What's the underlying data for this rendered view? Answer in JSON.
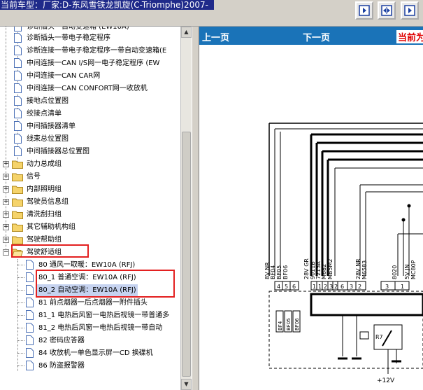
{
  "window": {
    "title": "当前车型：厂家:D-东风雪铁龙凯旋(C-Triomphe)2007-"
  },
  "toolbar": {
    "icons": [
      "prev-page-icon",
      "fit-width-icon",
      "next-page-icon"
    ]
  },
  "tree": {
    "items": [
      {
        "label": "诊断插头一带电子稳定程序",
        "kind": "doc"
      },
      {
        "label": "诊断连接一带电子稳定程序一带自动变速箱(E",
        "kind": "doc"
      },
      {
        "label": "中间连接一CAN I/S网一电子稳定程序 (EW",
        "kind": "doc"
      },
      {
        "label": "中间连接一CAN CAR网",
        "kind": "doc"
      },
      {
        "label": "中间连接一CAN CONFORT网一收放机",
        "kind": "doc"
      },
      {
        "label": "接地点位置图",
        "kind": "doc"
      },
      {
        "label": "绞接点清单",
        "kind": "doc"
      },
      {
        "label": "中间插接器清单",
        "kind": "doc"
      },
      {
        "label": "线束总位置图",
        "kind": "doc"
      },
      {
        "label": "中间插接器总位置图",
        "kind": "doc"
      },
      {
        "label": "动力总成组",
        "kind": "folder"
      },
      {
        "label": "信号",
        "kind": "folder"
      },
      {
        "label": "内部照明组",
        "kind": "folder"
      },
      {
        "label": "驾驶员信息组",
        "kind": "folder"
      },
      {
        "label": "清洗刮扫组",
        "kind": "folder"
      },
      {
        "label": "其它辅助机构组",
        "kind": "folder"
      },
      {
        "label": "驾驶帮助组",
        "kind": "folder"
      },
      {
        "label": "驾驶舒适组",
        "kind": "folder-open"
      },
      {
        "label": "80 通风一取暖：EW10A (RFJ)",
        "kind": "sub"
      },
      {
        "label": "80_1 普通空调：EW10A (RFJ)",
        "kind": "sub"
      },
      {
        "label": "80_2 自动空调：EW10A (RFJ)",
        "kind": "sub-selected"
      },
      {
        "label": "81 前点烟器一后点烟器一附件插头",
        "kind": "sub"
      },
      {
        "label": "81_1 电热后风窗一电热后视镜一带普通多",
        "kind": "sub"
      },
      {
        "label": "81_2 电热后风窗一电热后视镜一带自动",
        "kind": "sub"
      },
      {
        "label": "82 密码应答器",
        "kind": "sub"
      },
      {
        "label": "84 收放机一单色显示屏一CD 换碟机",
        "kind": "sub"
      },
      {
        "label": "86 防盗报警器",
        "kind": "sub"
      }
    ],
    "first_partial": "诊断插头一自动变速箱 (EW10A)"
  },
  "nav": {
    "prev": "上一页",
    "next": "下一页",
    "current": "当前为"
  },
  "diagram": {
    "wire_labels": [
      "8V NR",
      "BF04",
      "BF05",
      "BF06",
      "28V GR",
      "9011B",
      "7213A",
      "M682",
      "MB5M2",
      "28V NR",
      "M6583",
      "8020",
      "5V JN",
      "MC80P"
    ],
    "pin_numbers": [
      "4",
      "5",
      "6",
      "1",
      "1",
      "2",
      "3",
      "2",
      "6",
      "3",
      "2",
      "3",
      "1"
    ],
    "fuse_labels": [
      "BF4",
      "BF05",
      "BF06"
    ],
    "relay_label": "R7",
    "voltage": "+12V"
  }
}
